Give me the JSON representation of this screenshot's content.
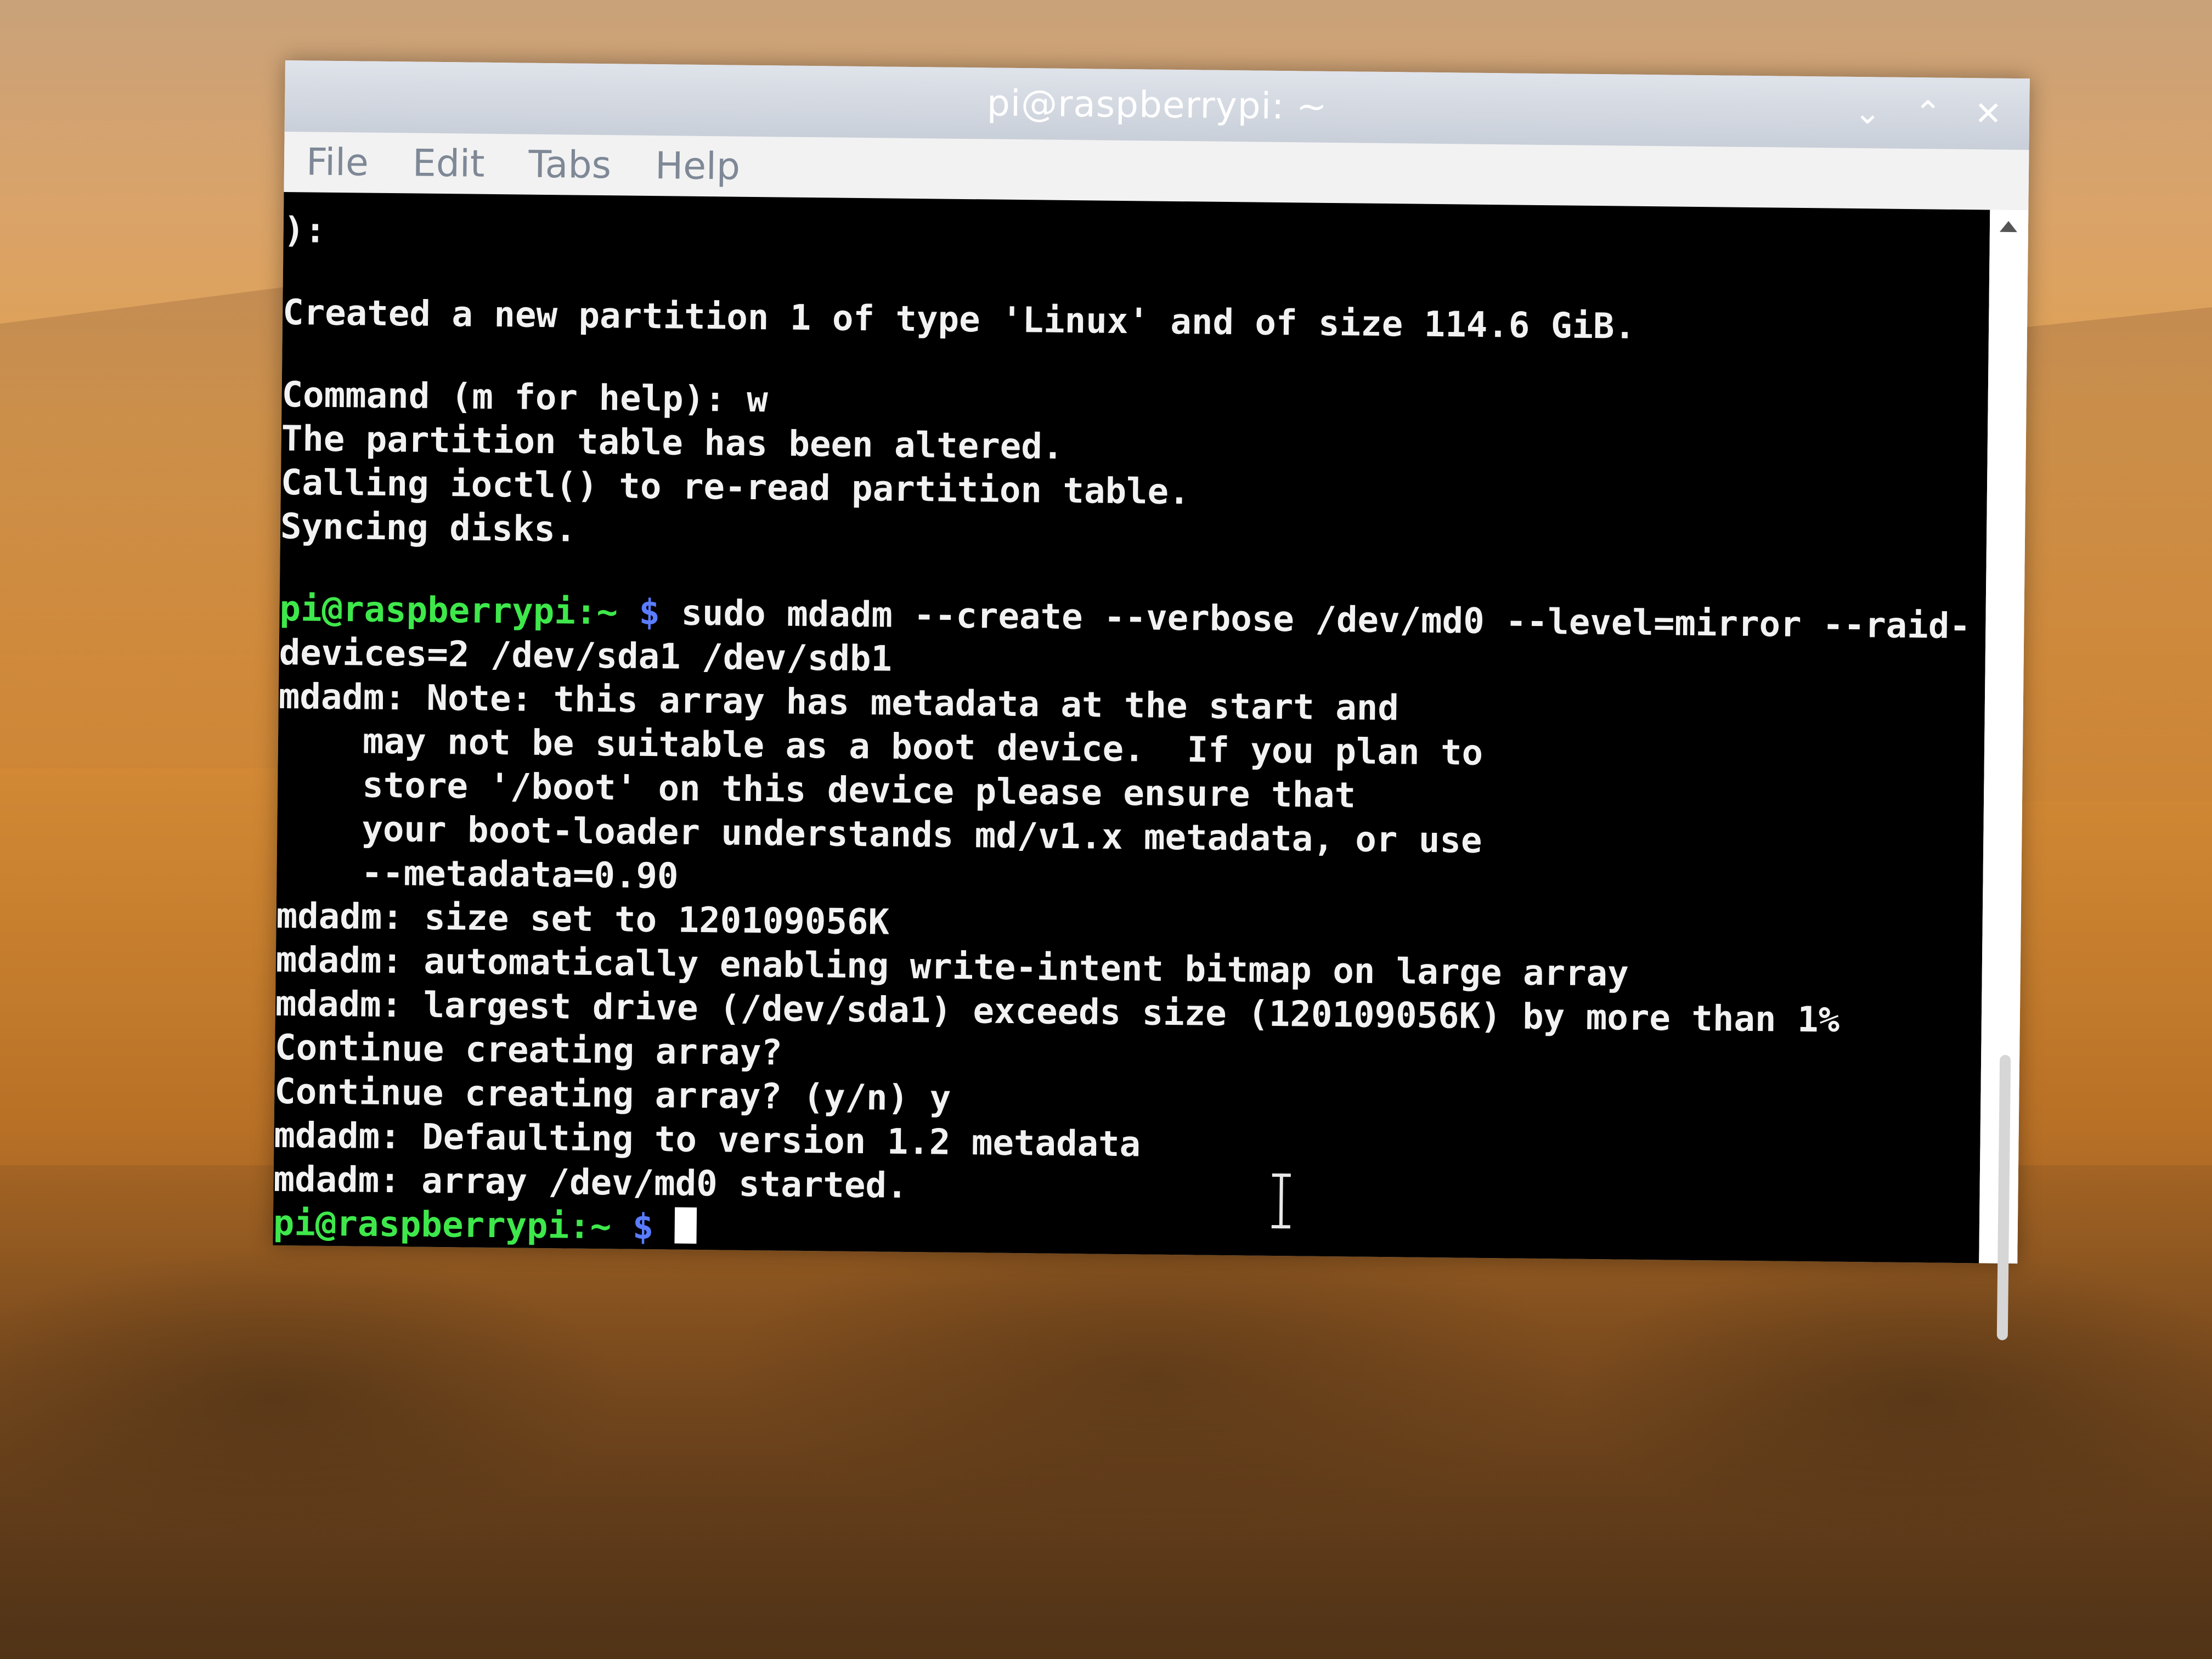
{
  "window": {
    "title": "pi@raspberrypi: ~",
    "controls": {
      "minimize": "⌄",
      "maximize": "⌃",
      "close": "✕"
    }
  },
  "menu": {
    "items": [
      "File",
      "Edit",
      "Tabs",
      "Help"
    ]
  },
  "terminal": {
    "lines": [
      "):",
      "",
      "Created a new partition 1 of type 'Linux' and of size 114.6 GiB.",
      "",
      "Command (m for help): w",
      "The partition table has been altered.",
      "Calling ioctl() to re-read partition table.",
      "Syncing disks.",
      ""
    ],
    "prompt_user": "pi@raspberrypi:~",
    "prompt_symbol": "$",
    "command_line": " sudo mdadm --create --verbose /dev/md0 --level=mirror --raid-",
    "command_continuation": "devices=2 /dev/sda1 /dev/sdb1",
    "output": [
      "mdadm: Note: this array has metadata at the start and",
      "    may not be suitable as a boot device.  If you plan to",
      "    store '/boot' on this device please ensure that",
      "    your boot-loader understands md/v1.x metadata, or use",
      "    --metadata=0.90",
      "mdadm: size set to 120109056K",
      "mdadm: automatically enabling write-intent bitmap on large array",
      "mdadm: largest drive (/dev/sda1) exceeds size (120109056K) by more than 1%",
      "Continue creating array?",
      "Continue creating array? (y/n) y",
      "mdadm: Defaulting to version 1.2 metadata",
      "mdadm: array /dev/md0 started."
    ],
    "final_prompt_user": "pi@raspberrypi:~",
    "final_prompt_symbol": "$"
  },
  "colors": {
    "prompt_user": "#3ee84b",
    "prompt_symbol": "#5a7cff",
    "terminal_bg": "#000000",
    "terminal_fg": "#f2f2f2"
  }
}
